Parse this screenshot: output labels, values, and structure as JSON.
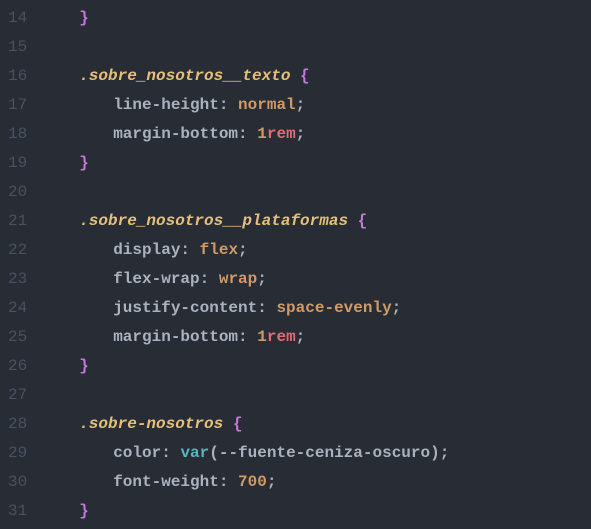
{
  "gutter": {
    "start": 14,
    "end": 31
  },
  "lines": {
    "14": {
      "indent": "i1",
      "tokens": [
        {
          "cls": "brace",
          "t": "}"
        }
      ]
    },
    "15": {
      "indent": "",
      "tokens": []
    },
    "16": {
      "indent": "i1",
      "tokens": [
        {
          "cls": "selector",
          "t": ".sobre_nosotros__texto"
        },
        {
          "cls": "",
          "t": " "
        },
        {
          "cls": "brace",
          "t": "{"
        }
      ]
    },
    "17": {
      "indent": "i2",
      "tokens": [
        {
          "cls": "prop",
          "t": "line-height"
        },
        {
          "cls": "punct",
          "t": ":"
        },
        {
          "cls": "",
          "t": " "
        },
        {
          "cls": "val-keyword",
          "t": "normal"
        },
        {
          "cls": "semi",
          "t": ";"
        }
      ]
    },
    "18": {
      "indent": "i2",
      "tokens": [
        {
          "cls": "prop",
          "t": "margin-bottom"
        },
        {
          "cls": "punct",
          "t": ":"
        },
        {
          "cls": "",
          "t": " "
        },
        {
          "cls": "val-num",
          "t": "1"
        },
        {
          "cls": "val-unit",
          "t": "rem"
        },
        {
          "cls": "semi",
          "t": ";"
        }
      ]
    },
    "19": {
      "indent": "i1",
      "tokens": [
        {
          "cls": "brace",
          "t": "}"
        }
      ]
    },
    "20": {
      "indent": "",
      "tokens": []
    },
    "21": {
      "indent": "i1",
      "tokens": [
        {
          "cls": "selector",
          "t": ".sobre_nosotros__plataformas"
        },
        {
          "cls": "",
          "t": " "
        },
        {
          "cls": "brace",
          "t": "{"
        }
      ]
    },
    "22": {
      "indent": "i2",
      "tokens": [
        {
          "cls": "prop",
          "t": "display"
        },
        {
          "cls": "punct",
          "t": ":"
        },
        {
          "cls": "",
          "t": " "
        },
        {
          "cls": "val-keyword",
          "t": "flex"
        },
        {
          "cls": "semi",
          "t": ";"
        }
      ]
    },
    "23": {
      "indent": "i2",
      "tokens": [
        {
          "cls": "prop",
          "t": "flex-wrap"
        },
        {
          "cls": "punct",
          "t": ":"
        },
        {
          "cls": "",
          "t": " "
        },
        {
          "cls": "val-keyword",
          "t": "wrap"
        },
        {
          "cls": "semi",
          "t": ";"
        }
      ]
    },
    "24": {
      "indent": "i2",
      "tokens": [
        {
          "cls": "prop",
          "t": "justify-content"
        },
        {
          "cls": "punct",
          "t": ":"
        },
        {
          "cls": "",
          "t": " "
        },
        {
          "cls": "val-keyword",
          "t": "space-evenly"
        },
        {
          "cls": "semi",
          "t": ";"
        }
      ]
    },
    "25": {
      "indent": "i2",
      "tokens": [
        {
          "cls": "prop",
          "t": "margin-bottom"
        },
        {
          "cls": "punct",
          "t": ":"
        },
        {
          "cls": "",
          "t": " "
        },
        {
          "cls": "val-num",
          "t": "1"
        },
        {
          "cls": "val-unit",
          "t": "rem"
        },
        {
          "cls": "semi",
          "t": ";"
        }
      ]
    },
    "26": {
      "indent": "i1",
      "tokens": [
        {
          "cls": "brace",
          "t": "}"
        }
      ]
    },
    "27": {
      "indent": "",
      "tokens": []
    },
    "28": {
      "indent": "i1",
      "tokens": [
        {
          "cls": "selector",
          "t": ".sobre-nosotros"
        },
        {
          "cls": "",
          "t": " "
        },
        {
          "cls": "brace",
          "t": "{"
        }
      ]
    },
    "29": {
      "indent": "i2",
      "tokens": [
        {
          "cls": "prop",
          "t": "color"
        },
        {
          "cls": "punct",
          "t": ":"
        },
        {
          "cls": "",
          "t": " "
        },
        {
          "cls": "func",
          "t": "var"
        },
        {
          "cls": "punct",
          "t": "("
        },
        {
          "cls": "var-arg",
          "t": "--fuente-ceniza-oscuro"
        },
        {
          "cls": "punct",
          "t": ")"
        },
        {
          "cls": "semi",
          "t": ";"
        }
      ]
    },
    "30": {
      "indent": "i2",
      "tokens": [
        {
          "cls": "prop",
          "t": "font-weight"
        },
        {
          "cls": "punct",
          "t": ":"
        },
        {
          "cls": "",
          "t": " "
        },
        {
          "cls": "val-num",
          "t": "700"
        },
        {
          "cls": "semi",
          "t": ";"
        }
      ]
    },
    "31": {
      "indent": "i1",
      "tokens": [
        {
          "cls": "brace",
          "t": "}"
        }
      ]
    }
  }
}
